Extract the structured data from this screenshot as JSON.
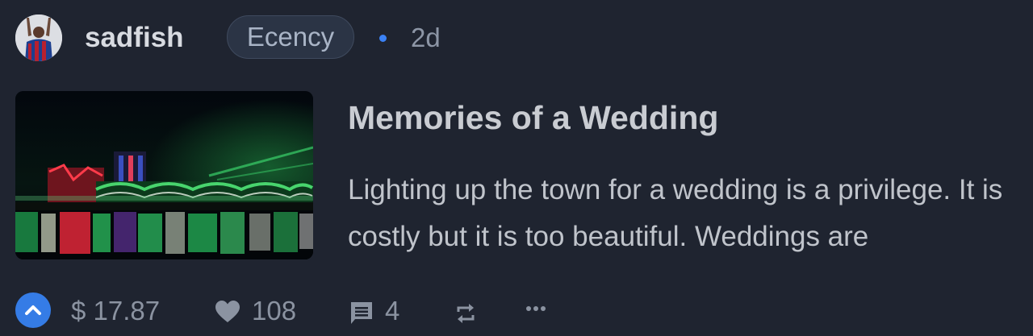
{
  "author": {
    "username": "sadfish",
    "avatar_icon": "avatar-photo"
  },
  "community": "Ecency",
  "age": "2d",
  "post": {
    "title": "Memories of a Wedding",
    "summary": "Lighting up the town for a wedding is a privilege. It is costly but it is too beautiful. Weddings are",
    "thumbnail_icon": "wedding-lights-photo"
  },
  "footer": {
    "payout": "$ 17.87",
    "likes": "108",
    "comments": "4",
    "icons": [
      "chevron-up-icon",
      "heart-icon",
      "comment-icon",
      "reblog-icon",
      "more-icon"
    ]
  },
  "colors": {
    "background": "#1f2430",
    "accent": "#357ce6",
    "dot": "#3b82f6",
    "muted": "#8b93a1"
  }
}
